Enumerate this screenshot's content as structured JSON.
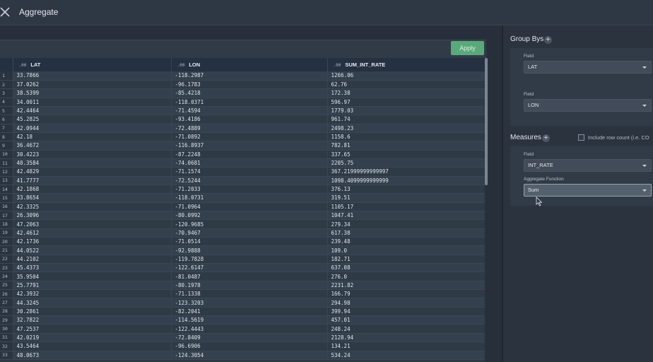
{
  "window": {
    "title": "Aggregate",
    "close_icon": "close-icon"
  },
  "toolbar": {
    "apply_label": "Apply"
  },
  "table": {
    "columns": [
      {
        "type": ".00",
        "name": "LAT"
      },
      {
        "type": ".00",
        "name": "LON"
      },
      {
        "type": ".00",
        "name": "SUM_INT_RATE"
      }
    ],
    "rows": [
      [
        "1",
        "33.7866",
        "-118.2987",
        "1266.06"
      ],
      [
        "2",
        "37.0262",
        "-96.1783",
        "62.76"
      ],
      [
        "3",
        "38.5399",
        "-85.4218",
        "172.38"
      ],
      [
        "4",
        "34.0011",
        "-118.0371",
        "596.97"
      ],
      [
        "5",
        "42.4464",
        "-71.4594",
        "1779.03"
      ],
      [
        "6",
        "45.2825",
        "-93.4186",
        "961.74"
      ],
      [
        "7",
        "42.0944",
        "-72.4889",
        "2498.23"
      ],
      [
        "8",
        "42.18",
        "-71.0892",
        "1158.6"
      ],
      [
        "9",
        "36.4672",
        "-116.8937",
        "782.81"
      ],
      [
        "10",
        "30.4223",
        "-87.2248",
        "337.65"
      ],
      [
        "11",
        "40.3584",
        "-74.0681",
        "2205.75"
      ],
      [
        "12",
        "42.4829",
        "-71.1574",
        "367.21999999999997"
      ],
      [
        "13",
        "41.7777",
        "-72.5244",
        "1098.4099999999999"
      ],
      [
        "14",
        "42.1868",
        "-71.2033",
        "376.13"
      ],
      [
        "15",
        "33.8654",
        "-118.0731",
        "319.51"
      ],
      [
        "16",
        "42.3325",
        "-71.0964",
        "1105.17"
      ],
      [
        "17",
        "26.3096",
        "-80.0992",
        "1047.41"
      ],
      [
        "18",
        "47.2063",
        "-120.9685",
        "279.34"
      ],
      [
        "19",
        "42.4612",
        "-70.9467",
        "617.38"
      ],
      [
        "20",
        "42.1736",
        "-71.0514",
        "239.48"
      ],
      [
        "21",
        "44.0522",
        "-92.9888",
        "109.0"
      ],
      [
        "22",
        "44.2102",
        "-119.7828",
        "182.71"
      ],
      [
        "23",
        "45.4373",
        "-122.6147",
        "637.08"
      ],
      [
        "24",
        "35.9504",
        "-81.0487",
        "276.0"
      ],
      [
        "25",
        "25.7791",
        "-80.1978",
        "2231.82"
      ],
      [
        "26",
        "42.3932",
        "-71.1338",
        "166.79"
      ],
      [
        "27",
        "44.3245",
        "-123.3203",
        "294.98"
      ],
      [
        "28",
        "30.2861",
        "-82.2041",
        "399.94"
      ],
      [
        "29",
        "32.7822",
        "-114.5619",
        "457.01"
      ],
      [
        "30",
        "47.2537",
        "-122.4443",
        "248.24"
      ],
      [
        "31",
        "42.0219",
        "-72.8409",
        "2128.94"
      ],
      [
        "32",
        "43.5464",
        "-96.6906",
        "134.21"
      ],
      [
        "33",
        "48.0673",
        "-124.3054",
        "534.24"
      ]
    ]
  },
  "panel": {
    "group_bys_title": "Group Bys",
    "group_field1_label": "Field",
    "group_field1_value": "LAT",
    "group_field2_label": "Field",
    "group_field2_value": "LON",
    "measures_title": "Measures",
    "include_row_count_label": "Include row count (i.e. CO",
    "measure_field_label": "Field",
    "measure_field_value": "INT_RATE",
    "aggregate_function_label": "Aggregate Function",
    "aggregate_function_value": "Sum"
  }
}
